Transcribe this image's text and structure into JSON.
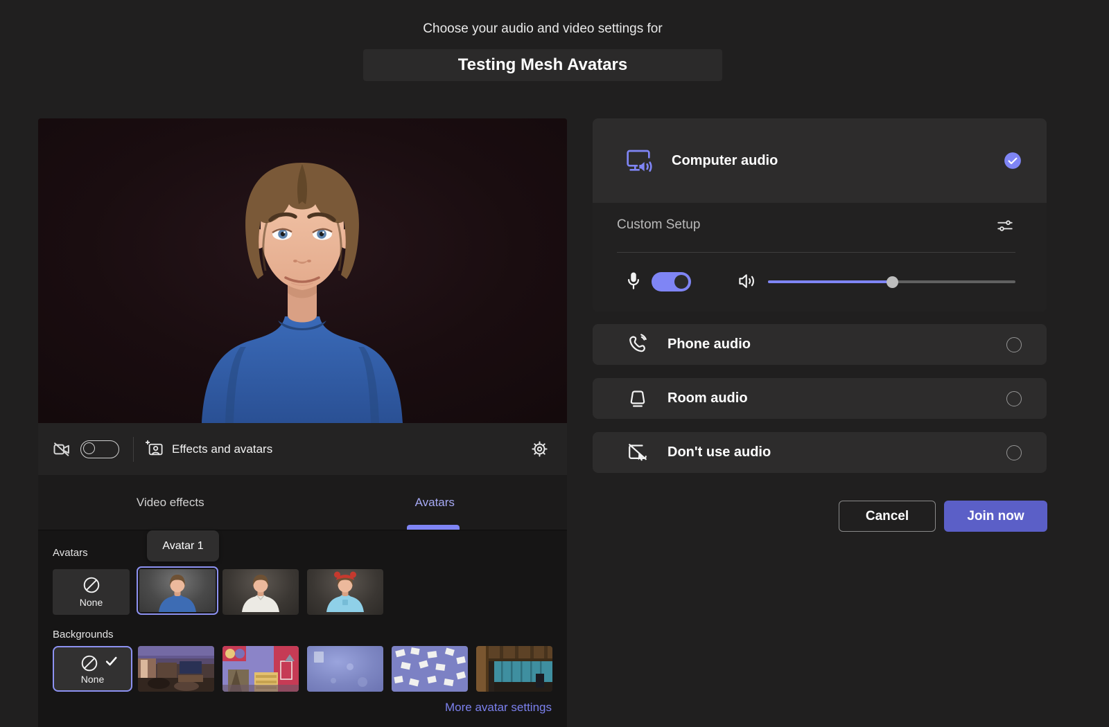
{
  "header": {
    "subtitle": "Choose your audio and video settings for",
    "meeting_title": "Testing Mesh Avatars"
  },
  "preview": {
    "camera": {
      "on": false
    },
    "effects_label": "Effects and avatars",
    "tabs": {
      "video_effects": "Video effects",
      "avatars": "Avatars",
      "active": "Avatars"
    },
    "avatars_section": {
      "label": "Avatars",
      "tooltip": "Avatar 1",
      "items": [
        {
          "label": "None",
          "selected": false
        },
        {
          "name": "Avatar 1",
          "selected": true,
          "shirt": "#3d6cb4"
        },
        {
          "name": "Avatar 2",
          "selected": false,
          "shirt": "#eceae4"
        },
        {
          "name": "Avatar 3",
          "selected": false,
          "shirt": "#8fd0e8",
          "hat": "#c6392e"
        }
      ]
    },
    "backgrounds_section": {
      "label": "Backgrounds",
      "items": [
        {
          "label": "None",
          "selected": true
        },
        {
          "name": "living-room"
        },
        {
          "name": "colorful-room"
        },
        {
          "name": "blue-blur"
        },
        {
          "name": "paper-notes"
        },
        {
          "name": "industrial-room"
        }
      ]
    },
    "more_link": "More avatar settings"
  },
  "audio": {
    "computer": {
      "label": "Computer audio",
      "selected": true
    },
    "custom_setup": {
      "label": "Custom Setup",
      "mic_on": true,
      "volume_percent": 50
    },
    "options": [
      {
        "label": "Phone audio",
        "selected": false
      },
      {
        "label": "Room audio",
        "selected": false
      },
      {
        "label": "Don't use audio",
        "selected": false
      }
    ]
  },
  "actions": {
    "cancel": "Cancel",
    "join": "Join now"
  },
  "colors": {
    "accent": "#5b5fc7",
    "accent_light": "#7f85f5"
  }
}
